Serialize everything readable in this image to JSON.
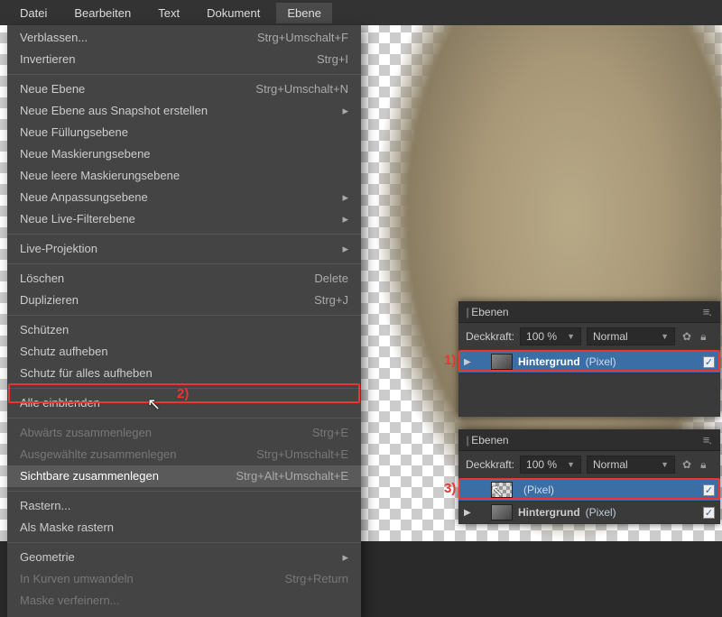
{
  "menubar": {
    "items": [
      "Datei",
      "Bearbeiten",
      "Text",
      "Dokument",
      "Ebene"
    ],
    "open_index": 4
  },
  "menu": {
    "groups": [
      [
        {
          "label": "Verblassen...",
          "sc": "Strg+Umschalt+F"
        },
        {
          "label": "Invertieren",
          "sc": "Strg+I"
        }
      ],
      [
        {
          "label": "Neue Ebene",
          "sc": "Strg+Umschalt+N"
        },
        {
          "label": "Neue Ebene aus Snapshot erstellen",
          "sub": true
        },
        {
          "label": "Neue Füllungsebene"
        },
        {
          "label": "Neue Maskierungsebene"
        },
        {
          "label": "Neue leere Maskierungsebene"
        },
        {
          "label": "Neue Anpassungsebene",
          "sub": true
        },
        {
          "label": "Neue Live-Filterebene",
          "sub": true
        }
      ],
      [
        {
          "label": "Live-Projektion",
          "sub": true
        }
      ],
      [
        {
          "label": "Löschen",
          "sc": "Delete"
        },
        {
          "label": "Duplizieren",
          "sc": "Strg+J"
        }
      ],
      [
        {
          "label": "Schützen"
        },
        {
          "label": "Schutz aufheben"
        },
        {
          "label": "Schutz für alles aufheben"
        }
      ],
      [
        {
          "label": "Alle einblenden"
        }
      ],
      [
        {
          "label": "Abwärts zusammenlegen",
          "sc": "Strg+E",
          "dis": true
        },
        {
          "label": "Ausgewählte zusammenlegen",
          "sc": "Strg+Umschalt+E",
          "dis": true
        },
        {
          "label": "Sichtbare zusammenlegen",
          "sc": "Strg+Alt+Umschalt+E",
          "hl": true
        }
      ],
      [
        {
          "label": "Rastern..."
        },
        {
          "label": "Als Maske rastern"
        }
      ],
      [
        {
          "label": "Geometrie",
          "sub": true
        },
        {
          "label": "In Kurven umwandeln",
          "sc": "Strg+Return",
          "dis": true
        },
        {
          "label": "Maske verfeinern...",
          "dis": true
        }
      ]
    ]
  },
  "panel": {
    "title": "Ebenen",
    "opacity_label": "Deckkraft:",
    "opacity_value": "100 %",
    "blend_mode": "Normal"
  },
  "p1_layers": [
    {
      "name": "Hintergrund",
      "type": "(Pixel)",
      "sel": true,
      "exp": "▶",
      "thumb": "img",
      "chk": true
    }
  ],
  "p2_layers": [
    {
      "name": "",
      "type": "(Pixel)",
      "sel": true,
      "exp": "",
      "thumb": "empty",
      "chk": true
    },
    {
      "name": "Hintergrund",
      "type": "(Pixel)",
      "sel": false,
      "exp": "▶",
      "thumb": "img",
      "chk": true
    }
  ],
  "annot": {
    "a1": "1)",
    "a2": "2)",
    "a3": "3)"
  }
}
